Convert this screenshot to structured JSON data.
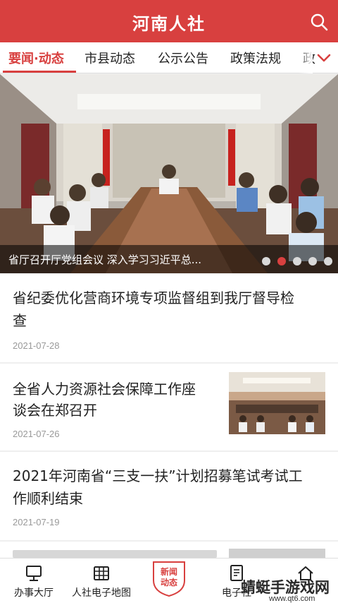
{
  "header": {
    "title": "河南人社",
    "search_icon": "search-icon",
    "color": "#d8403f"
  },
  "tabs": [
    {
      "label": "要闻·动态",
      "active": true
    },
    {
      "label": "市县动态",
      "active": false
    },
    {
      "label": "公示公告",
      "active": false
    },
    {
      "label": "政策法规",
      "active": false
    },
    {
      "label": "政",
      "active": false
    }
  ],
  "tabs_more_icon": "chevron-down-icon",
  "banner": {
    "caption": "省厅召开厅党组会议 深入学习习近平总...",
    "slide_count": 5,
    "active_slide": 2
  },
  "news": [
    {
      "title_line1": "省纪委优化营商环境专项监督组到我厅督导检",
      "title_line2": "查",
      "date": "2021-07-28",
      "has_thumbnail": false
    },
    {
      "title_line1": "全省人力资源社会保障工作座",
      "title_line2": "谈会在郑召开",
      "date": "2021-07-26",
      "has_thumbnail": true
    },
    {
      "title_line1": "2021年河南省“三支一扶”计划招募笔试考试工",
      "title_line2": "作顺利结束",
      "date": "2021-07-19",
      "has_thumbnail": false
    }
  ],
  "bottom_nav": {
    "items": [
      {
        "label": "办事大厅",
        "icon": "monitor-icon"
      },
      {
        "label": "人社电子地图",
        "icon": "map-grid-icon"
      },
      {
        "label": "电子社",
        "icon": "card-icon"
      },
      {
        "label": "",
        "icon": "home-icon"
      }
    ],
    "center_badge_line1": "新闻",
    "center_badge_line2": "动态"
  },
  "watermark": {
    "text": "蜻蜓手游戏网",
    "url": "www.qt6.com"
  }
}
